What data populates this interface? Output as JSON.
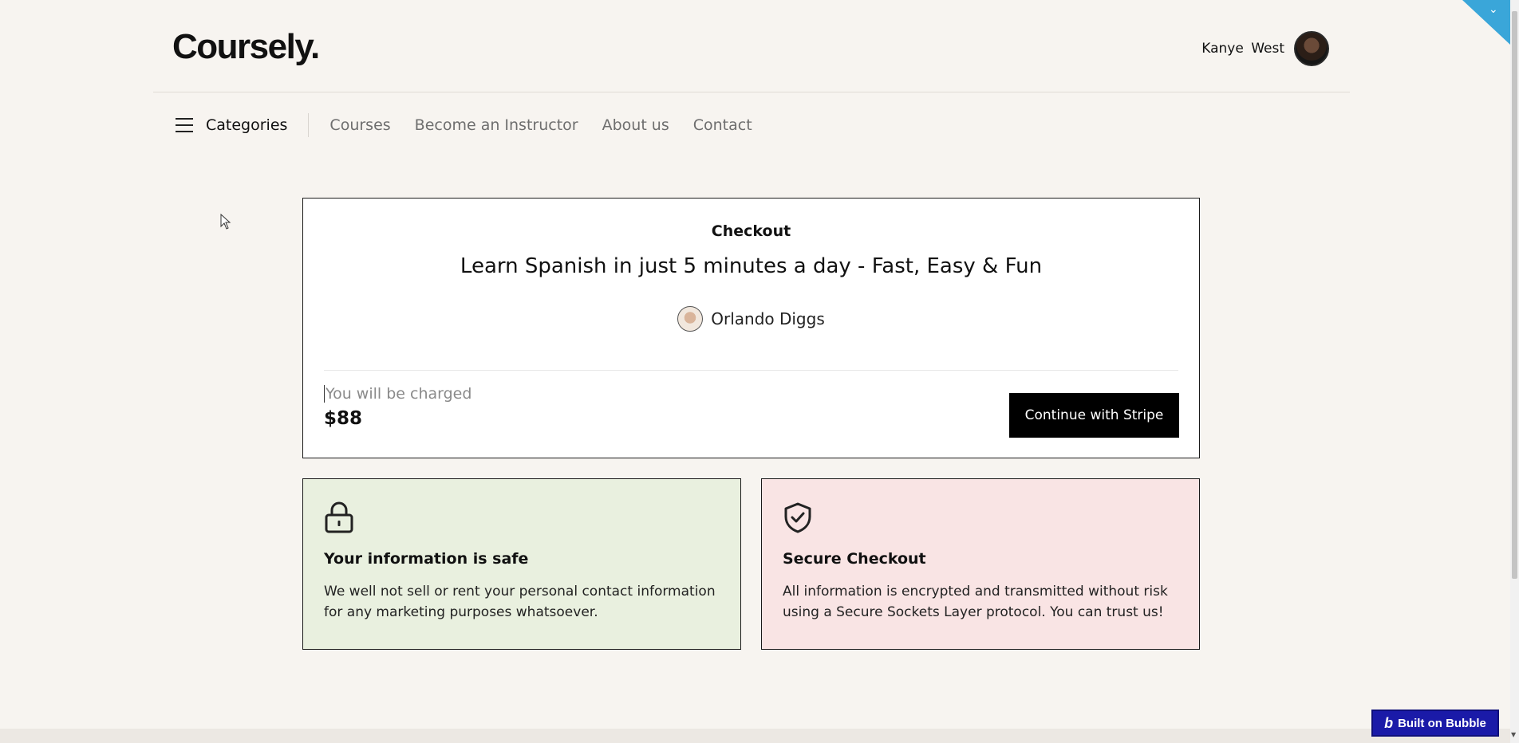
{
  "header": {
    "logo": "Coursely.",
    "user_name": "Kanye West"
  },
  "nav": {
    "categories_label": "Categories",
    "links": [
      "Courses",
      "Become an Instructor",
      "About us",
      "Contact"
    ]
  },
  "checkout": {
    "label": "Checkout",
    "course_title": "Learn Spanish in just 5 minutes a day - Fast, Easy & Fun",
    "instructor_name": "Orlando Diggs",
    "charge_label": "You will be charged",
    "charge_amount": "$88",
    "button_label": "Continue with Stripe"
  },
  "info_cards": [
    {
      "icon": "lock-icon",
      "title": "Your information is safe",
      "body": "We well not sell or rent your personal contact information for any marketing purposes whatsoever.",
      "background": "#e9f0df"
    },
    {
      "icon": "shield-check-icon",
      "title": "Secure Checkout",
      "body": "All information is encrypted and transmitted without risk using a Secure Sockets Layer protocol. You can trust us!",
      "background": "#f9e4e4"
    }
  ],
  "badge": {
    "label": "Built on Bubble",
    "color": "#1a1aa8"
  },
  "colors": {
    "page_background": "#f7f4f0",
    "accent_corner": "#3aa6d9",
    "button_background": "#000000"
  }
}
